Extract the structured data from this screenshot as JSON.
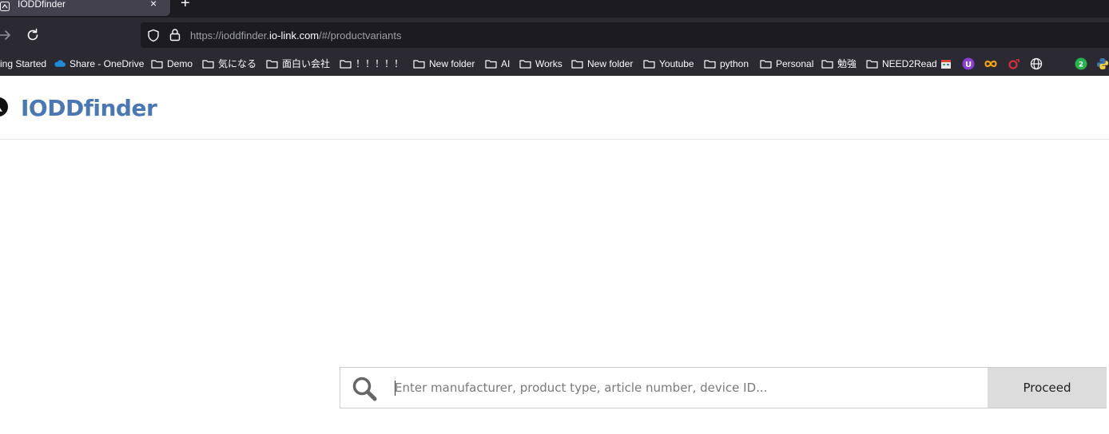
{
  "browser": {
    "tab": {
      "title": "IODDfinder"
    },
    "url": {
      "prefix": "https://ioddfinder.",
      "domain": "io-link.com",
      "path": "/#/productvariants"
    },
    "bookmarks": [
      {
        "label": "ing Started",
        "type": "text"
      },
      {
        "label": "Share - OneDrive",
        "type": "onedrive"
      },
      {
        "label": "Demo",
        "type": "folder"
      },
      {
        "label": "気になる",
        "type": "folder"
      },
      {
        "label": "面白い会社",
        "type": "folder"
      },
      {
        "label": "！！！！！",
        "type": "folder"
      },
      {
        "label": "New folder",
        "type": "folder"
      },
      {
        "label": "AI",
        "type": "folder"
      },
      {
        "label": "Works",
        "type": "folder"
      },
      {
        "label": "New folder",
        "type": "folder"
      },
      {
        "label": "Youtube",
        "type": "folder"
      },
      {
        "label": "python",
        "type": "folder"
      },
      {
        "label": "Personal",
        "type": "folder"
      },
      {
        "label": "勉強",
        "type": "folder"
      },
      {
        "label": "NEED2Read",
        "type": "folder"
      }
    ],
    "bookmark_icons": [
      "calendar-icon",
      "u-purple-icon",
      "infinity-icon",
      "o-red-icon",
      "globe-icon",
      "chat-badge-icon",
      "python-icon"
    ],
    "chat_badge_count": "2"
  },
  "site": {
    "title": "IODDfinder",
    "search": {
      "placeholder": "Enter manufacturer, product type, article number, device ID...",
      "value": "",
      "button_label": "Proceed"
    }
  },
  "colors": {
    "brand_blue": "#4a78b5",
    "browser_dark": "#2b2a33",
    "tabstrip": "#1c1b22",
    "button_gray": "#dcdcdc"
  }
}
